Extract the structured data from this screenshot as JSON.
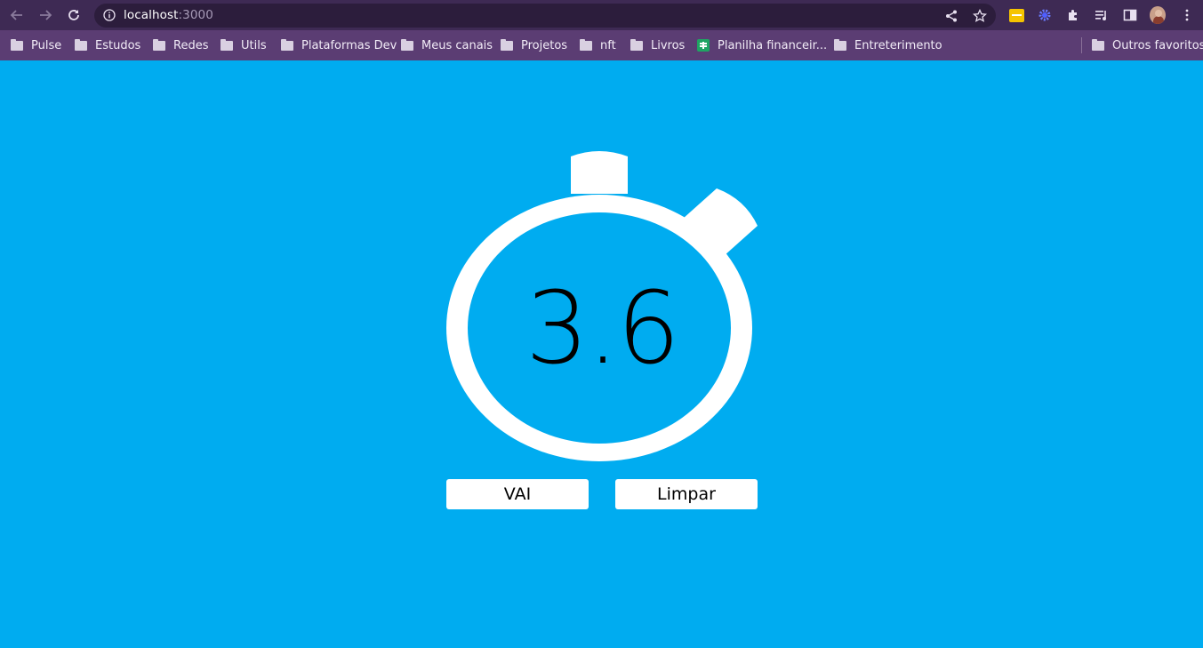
{
  "browser": {
    "url_host": "localhost",
    "url_port": ":3000",
    "bookmarks": [
      {
        "label": "Pulse",
        "icon": "folder-icon"
      },
      {
        "label": "Estudos",
        "icon": "folder-icon"
      },
      {
        "label": "Redes",
        "icon": "folder-icon"
      },
      {
        "label": "Utils",
        "icon": "folder-icon"
      },
      {
        "label": "Plataformas Dev",
        "icon": "folder-icon"
      },
      {
        "label": "Meus canais",
        "icon": "folder-icon"
      },
      {
        "label": "Projetos",
        "icon": "folder-icon"
      },
      {
        "label": "nft",
        "icon": "folder-icon"
      },
      {
        "label": "Livros",
        "icon": "folder-icon"
      },
      {
        "label": "Planilha financeir...",
        "icon": "sheets-icon"
      },
      {
        "label": "Entreterimento",
        "icon": "folder-icon"
      }
    ],
    "other_bookmarks": "Outros favoritos"
  },
  "stopwatch": {
    "time": "3.6"
  },
  "controls": {
    "start_label": "VAI",
    "clear_label": "Limpar"
  },
  "colors": {
    "page_background": "#00acf0",
    "stopwatch_body": "#ffffff",
    "toolbar": "#3e2a54",
    "bookmarks_bar": "#5b3d73"
  }
}
